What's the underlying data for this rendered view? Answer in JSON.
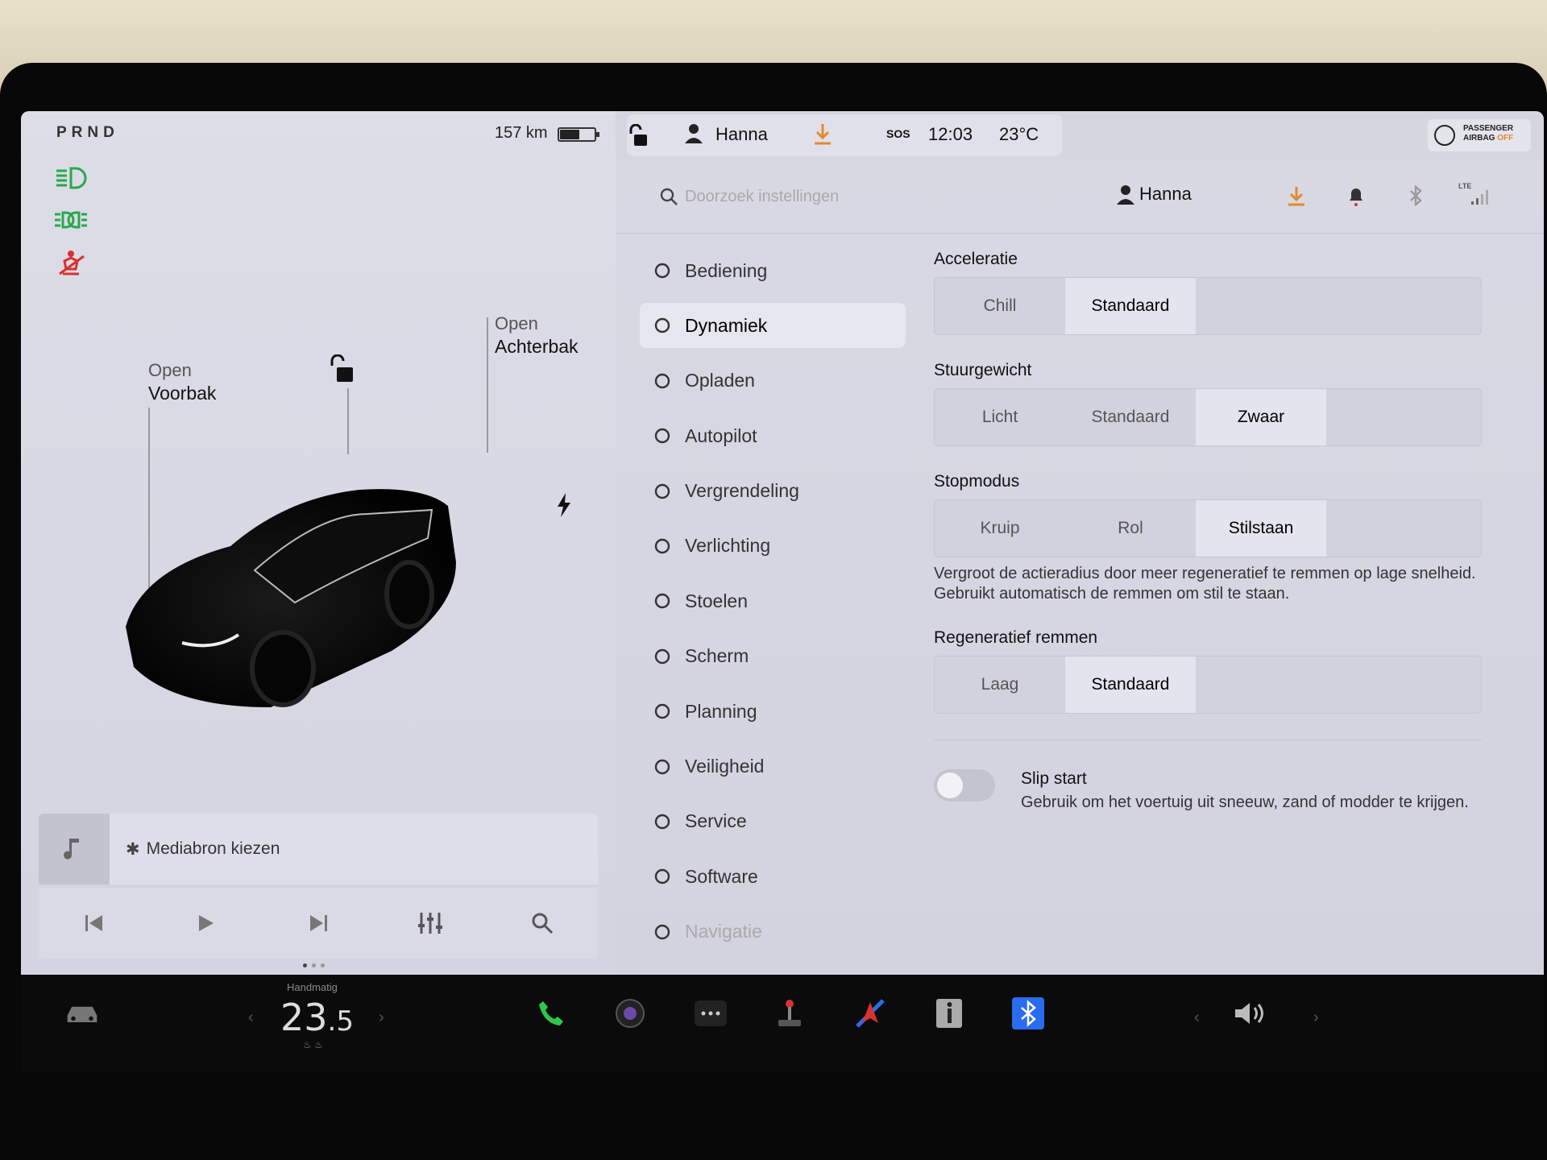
{
  "vehicle": {
    "gear": "PRND",
    "range": "157 km",
    "battery_level": 0.55,
    "front_trunk": {
      "status": "Open",
      "name": "Voorbak"
    },
    "rear_trunk": {
      "status": "Open",
      "name": "Achterbak"
    }
  },
  "media": {
    "source_label": "Mediabron kiezen",
    "page_dots": 3
  },
  "status_bar": {
    "user": "Hanna",
    "sos": "SOS",
    "time": "12:03",
    "temperature": "23°C",
    "airbag_line1": "PASSENGER",
    "airbag_line2": "AIRBAG",
    "airbag_line3": "OFF"
  },
  "settings_header": {
    "search_placeholder": "Doorzoek instellingen",
    "user": "Hanna",
    "network": "LTE"
  },
  "nav": {
    "items": [
      {
        "label": "Bediening",
        "icon": "toggle-icon"
      },
      {
        "label": "Dynamiek",
        "icon": "car-icon",
        "active": true
      },
      {
        "label": "Opladen",
        "icon": "bolt-icon"
      },
      {
        "label": "Autopilot",
        "icon": "steering-wheel-icon"
      },
      {
        "label": "Vergrendeling",
        "icon": "lock-icon"
      },
      {
        "label": "Verlichting",
        "icon": "sun-icon"
      },
      {
        "label": "Stoelen",
        "icon": "seat-icon"
      },
      {
        "label": "Scherm",
        "icon": "display-icon"
      },
      {
        "label": "Planning",
        "icon": "alarm-icon"
      },
      {
        "label": "Veiligheid",
        "icon": "alert-icon"
      },
      {
        "label": "Service",
        "icon": "wrench-icon"
      },
      {
        "label": "Software",
        "icon": "download-icon"
      },
      {
        "label": "Navigatie",
        "icon": "navigation-icon"
      }
    ]
  },
  "dynamics": {
    "acceleration": {
      "title": "Acceleratie",
      "options": [
        "Chill",
        "Standaard"
      ],
      "selected": "Standaard"
    },
    "steering": {
      "title": "Stuurgewicht",
      "options": [
        "Licht",
        "Standaard",
        "Zwaar"
      ],
      "selected": "Zwaar"
    },
    "stop_mode": {
      "title": "Stopmodus",
      "options": [
        "Kruip",
        "Rol",
        "Stilstaan"
      ],
      "selected": "Stilstaan",
      "description": "Vergroot de actieradius door meer regeneratief te remmen op lage snelheid. Gebruikt automatisch de remmen om stil te staan."
    },
    "regen": {
      "title": "Regeneratief remmen",
      "options": [
        "Laag",
        "Standaard"
      ],
      "selected": "Standaard"
    },
    "slip_start": {
      "title": "Slip start",
      "description": "Gebruik om het voertuig uit sneeuw, zand of modder te krijgen.",
      "enabled": false
    }
  },
  "bottom_bar": {
    "climate_mode": "Handmatig",
    "temp_whole": "23",
    "temp_decimal": ".5"
  },
  "colors": {
    "indicator_green": "#27a94a",
    "seatbelt_red": "#d7322f",
    "download_orange": "#e08a30",
    "bluetooth_blue": "#2a6cf0",
    "phone_green": "#2ec84a"
  }
}
